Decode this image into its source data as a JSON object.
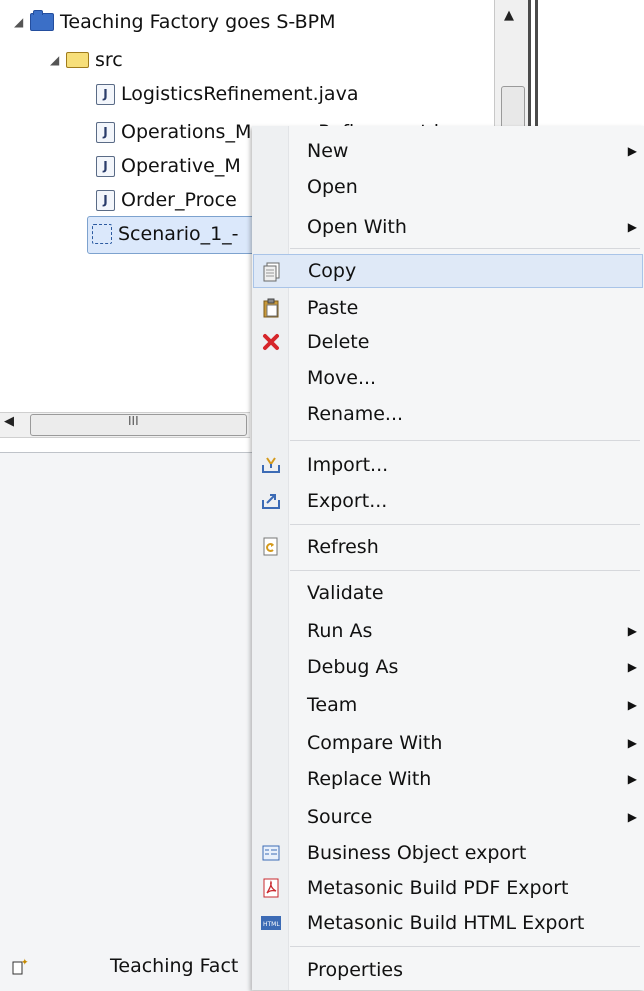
{
  "tree": {
    "project": "Teaching Factory goes S-BPM",
    "folder": "src",
    "files": [
      "LogisticsRefinement.java",
      "Operations_ManagerRefinement.java",
      "Operative_M",
      "Order_Proce",
      "Scenario_1_-"
    ],
    "scroll_marker": "III"
  },
  "status": {
    "icon": "new-item-icon",
    "label": "Teaching Fact"
  },
  "menu": {
    "new": "New",
    "open": "Open",
    "open_with": "Open With",
    "copy": "Copy",
    "paste": "Paste",
    "delete": "Delete",
    "move": "Move...",
    "rename": "Rename...",
    "import": "Import...",
    "export": "Export...",
    "refresh": "Refresh",
    "validate": "Validate",
    "run_as": "Run As",
    "debug_as": "Debug As",
    "team": "Team",
    "compare_with": "Compare With",
    "replace_with": "Replace With",
    "source": "Source",
    "business_object_export": "Business Object export",
    "pdf_export": "Metasonic Build PDF Export",
    "html_export": "Metasonic Build HTML Export",
    "properties": "Properties"
  },
  "colors": {
    "highlight": "#dfe9f7",
    "delete_icon": "#d6262b",
    "pdf_icon": "#c8282e"
  }
}
